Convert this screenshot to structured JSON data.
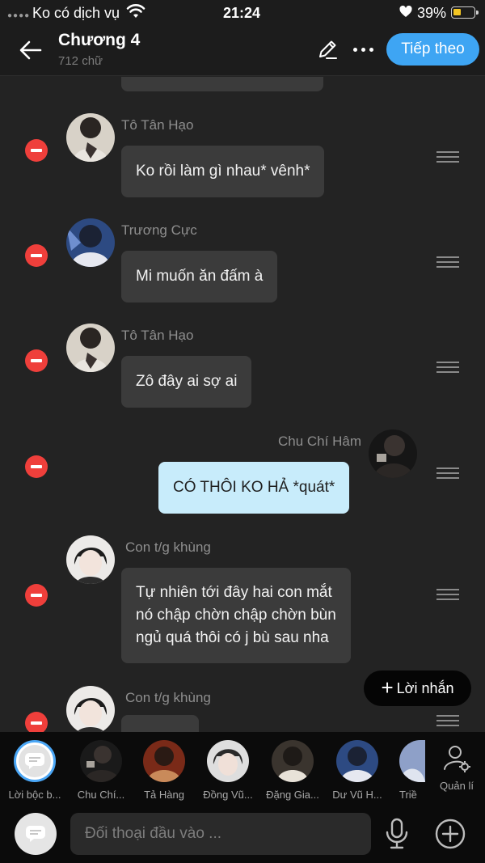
{
  "status_bar": {
    "carrier": "Ko có dịch vụ",
    "time": "21:24",
    "battery": "39%",
    "battery_level": 0.39,
    "icons": [
      "signal-dots-icon",
      "wifi-icon",
      "heart-icon",
      "battery-icon"
    ]
  },
  "header": {
    "title": "Chương 4",
    "word_count": "712 chữ",
    "next_label": "Tiếp theo",
    "icons": [
      "back-arrow-icon",
      "pencil-icon",
      "more-dots-icon"
    ]
  },
  "messages": [
    {
      "sender": "Tô Tân Hạo",
      "text": "Ko rồi làm gì nhau* vênh*",
      "side": "left"
    },
    {
      "sender": "Trương Cực",
      "text": "Mi muốn ăn đấm à",
      "side": "left"
    },
    {
      "sender": "Tô Tân Hạo",
      "text": "Zô đây ai sợ ai",
      "side": "left"
    },
    {
      "sender": "Chu Chí Hâm",
      "text": "CÓ THÔI KO HẢ *quát*",
      "side": "right"
    },
    {
      "sender": "Con t/g khùng",
      "lines": [
        "Tự nhiên tới đây hai con mắt",
        "nó chập chờn chập chờn bùn",
        "ngủ quá thôi có j bù sau nha"
      ],
      "side": "left"
    },
    {
      "sender": "Con t/g khùng",
      "text": "",
      "side": "left"
    }
  ],
  "new_message_label": "Lời nhắn",
  "characters": [
    {
      "label": "Lời bộc b..."
    },
    {
      "label": "Chu Chí..."
    },
    {
      "label": "Tả Hàng"
    },
    {
      "label": "Đồng Vũ..."
    },
    {
      "label": "Đặng Gia..."
    },
    {
      "label": "Dư Vũ H..."
    },
    {
      "label": "Triề"
    }
  ],
  "manage_label": "Quản lí",
  "input": {
    "placeholder": "Đối thoại đầu vào ..."
  },
  "colors": {
    "accent": "#3ea5f3",
    "delete": "#ef3f3b",
    "own_bubble": "#c8ecfb",
    "bubble": "#3b3b3b",
    "background": "#232323",
    "battery": "#f3c623"
  }
}
